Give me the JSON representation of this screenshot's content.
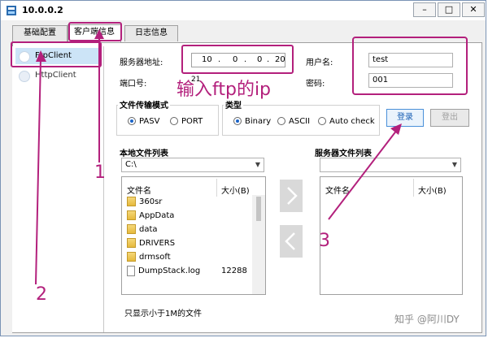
{
  "window": {
    "title": "10.0.0.2"
  },
  "tabs": [
    {
      "label": "基础配置"
    },
    {
      "label": "客户端信息"
    },
    {
      "label": "日志信息"
    }
  ],
  "sidebar": {
    "items": [
      {
        "label": "FtpClient"
      },
      {
        "label": "HttpClient"
      }
    ]
  },
  "form": {
    "server_addr_label": "服务器地址:",
    "ip_octets": [
      "10",
      "0",
      "0",
      "20"
    ],
    "port_label": "端口号:",
    "port_value": "21",
    "user_label": "用户名:",
    "user_value": "test",
    "pwd_label": "密码:",
    "pwd_value": "001"
  },
  "transfer_mode": {
    "title": "文件传输模式",
    "options": [
      "PASV",
      "PORT"
    ],
    "selected": "PASV"
  },
  "type": {
    "title": "类型",
    "options": [
      "Binary",
      "ASCII",
      "Auto check"
    ],
    "selected": "Binary"
  },
  "buttons": {
    "login": "登录",
    "logout": "登出"
  },
  "local": {
    "title": "本地文件列表",
    "path": "C:\\",
    "col_name": "文件名",
    "col_size": "大小(B)",
    "files": [
      {
        "name": "360sr",
        "size": "",
        "kind": "folder"
      },
      {
        "name": "AppData",
        "size": "",
        "kind": "folder"
      },
      {
        "name": "data",
        "size": "",
        "kind": "folder"
      },
      {
        "name": "DRIVERS",
        "size": "",
        "kind": "folder"
      },
      {
        "name": "drmsoft",
        "size": "",
        "kind": "folder"
      },
      {
        "name": "DumpStack.log",
        "size": "12288",
        "kind": "file"
      }
    ]
  },
  "server": {
    "title": "服务器文件列表",
    "path": "",
    "col_name": "文件名",
    "col_size": "大小(B)"
  },
  "footer_checkbox": "只显示小于1M的文件",
  "annotations": {
    "ip_hint": "输入ftp的ip",
    "n1": "1",
    "n2": "2",
    "n3": "3"
  },
  "watermark": "知乎 @阿川DY",
  "colors": {
    "annotation": "#b3207c",
    "selection": "#cce4f7"
  }
}
